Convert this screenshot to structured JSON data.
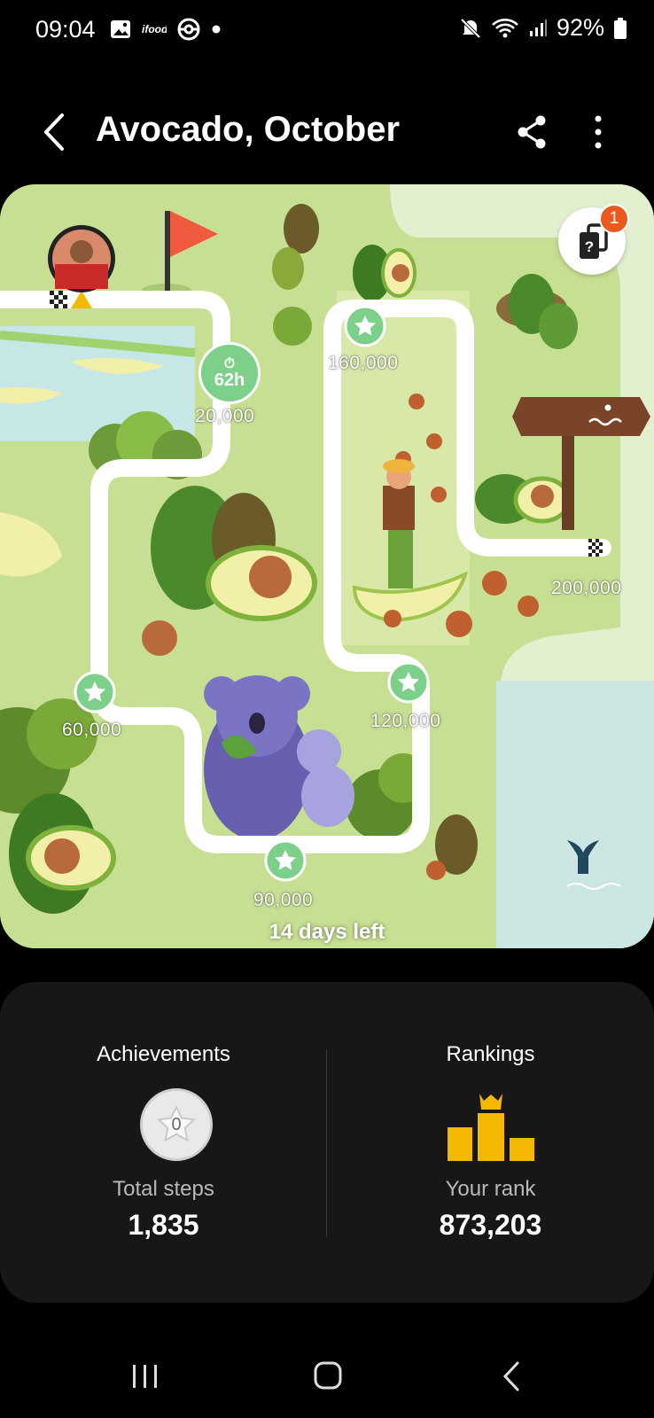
{
  "status_bar": {
    "time": "09:04",
    "battery": "92%",
    "left_icons": [
      "image-icon",
      "ifood-icon",
      "pokeball-icon",
      "dot-icon"
    ],
    "right_icons": [
      "mute-icon",
      "wifi-icon",
      "signal-icon",
      "battery-icon"
    ]
  },
  "header": {
    "title": "Avocado, October"
  },
  "map": {
    "help_badge": "1",
    "timer": "62h",
    "milestones": [
      "20,000",
      "60,000",
      "90,000",
      "120,000",
      "160,000",
      "200,000"
    ],
    "days_left": "14 days left"
  },
  "stats": {
    "achievements_title": "Achievements",
    "achievements_count": "0",
    "total_steps_label": "Total steps",
    "total_steps_value": "1,835",
    "rankings_title": "Rankings",
    "your_rank_label": "Your rank",
    "your_rank_value": "873,203"
  },
  "colors": {
    "map_grass": "#c7df92",
    "path": "#ffffff",
    "milestone_green": "#7cd08a",
    "badge_orange": "#ea5a1f",
    "gold": "#f5b800",
    "card_bg": "#171717"
  }
}
